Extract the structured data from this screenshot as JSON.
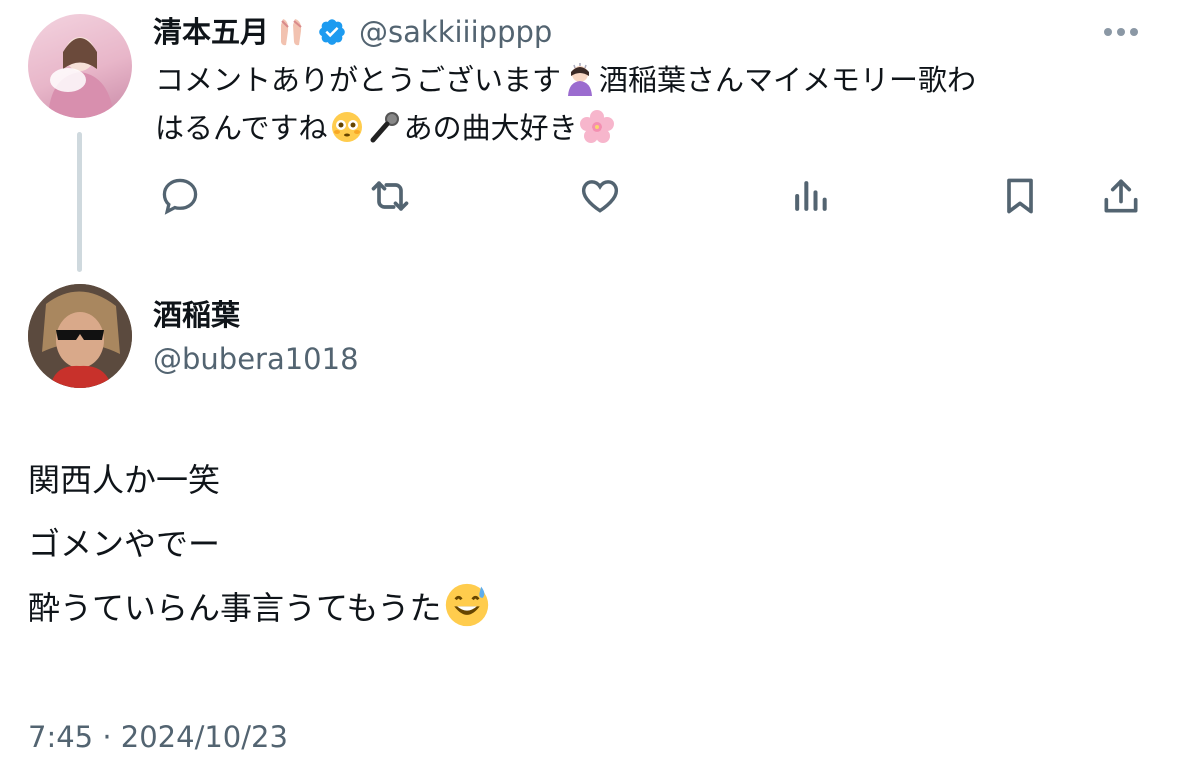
{
  "reply_tweet": {
    "display_name": "清本五月",
    "handle": "@sakkiiipppp",
    "text_line1": "コメントありがとうございます",
    "text_line1b": "酒稲葉さんマイメモリー歌わ",
    "text_line2a": "はるんですね",
    "text_line2b": "あの曲大好き",
    "emoji": [
      "ballet-shoes",
      "verified-badge",
      "woman-bowing",
      "flushed-face",
      "microphone",
      "cherry-blossom"
    ]
  },
  "actions": [
    "reply",
    "retweet",
    "like",
    "views",
    "bookmark",
    "share"
  ],
  "main_tweet": {
    "display_name": "酒稲葉",
    "handle": "@bubera1018",
    "lines": [
      "関西人か一笑",
      "ゴメンやでー",
      "酔うていらん事言うてもうた"
    ],
    "emoji": [
      "grinning-sweat"
    ],
    "timestamp": "7:45 · 2024/10/23"
  },
  "colors": {
    "accent": "#1d9bf0",
    "secondary_text": "#536471",
    "thread_line": "#cfd9de"
  }
}
